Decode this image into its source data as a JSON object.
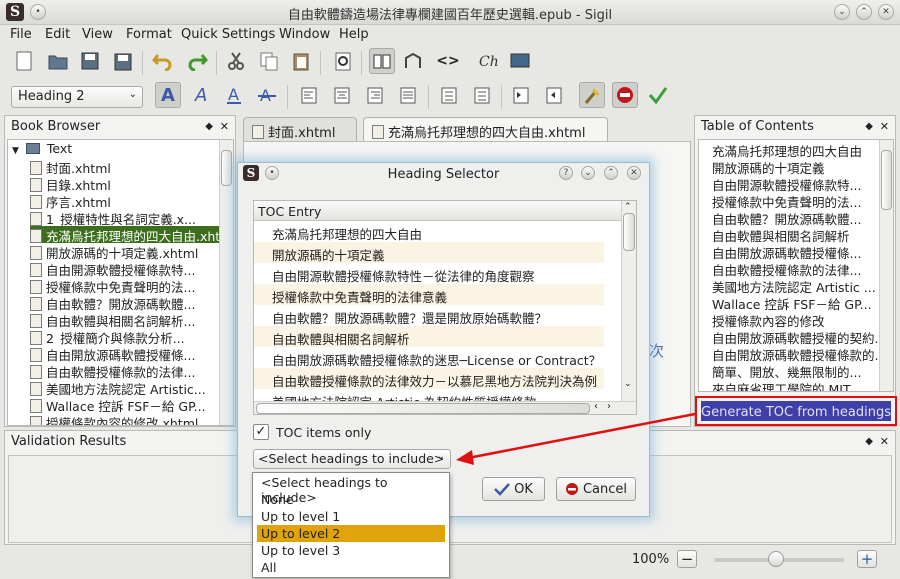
{
  "window": {
    "title": "自由軟體鑄造場法律專欄建國百年歷史選輯.epub - Sigil"
  },
  "menu": [
    "File",
    "Edit",
    "View",
    "Format",
    "Quick Settings",
    "Window",
    "Help"
  ],
  "toolbar": {
    "heading_combo": "Heading 2"
  },
  "book_browser": {
    "title": "Book Browser",
    "folder": "Text",
    "files": [
      "封面.xhtml",
      "目錄.xhtml",
      "序言.xhtml",
      "1_授權特性與名詞定義.x...",
      "充滿烏托邦理想的四大自由.xhtml",
      "開放源碼的十項定義.xhtml",
      "自由開源軟體授權條款特...",
      "授權條款中免責聲明的法...",
      "自由軟體？開放源碼軟體...",
      "自由軟體與相關名詞解析...",
      "2_授權簡介與條款分析...",
      "自由開放源碼軟體授權條...",
      "自由軟體授權條款的法律...",
      "美國地方法院認定 Artistic...",
      "Wallace 控訴 FSF－給 GP...",
      "授權條款內容的修改.xhtml"
    ],
    "selected_index": 4
  },
  "tabs": [
    {
      "label": "封面.xhtml"
    },
    {
      "label": "充滿烏托邦理想的四大自由.xhtml"
    }
  ],
  "toc_panel": {
    "title": "Table of Contents",
    "entries": [
      "充滿烏托邦理想的四大自由",
      "開放源碼的十項定義",
      "自由開源軟體授權條款特...",
      "授權條款中免責聲明的法...",
      "自由軟體？開放源碼軟體...",
      "自由軟體與相關名詞解析",
      "自由開放源碼軟體授權條...",
      "自由軟體授權條款的法律...",
      "美國地方法院認定 Artistic ...",
      "Wallace 控訴 FSF－給 GP...",
      "授權條款內容的修改",
      "自由開放源碼軟體授權的契約...",
      "自由開放源碼軟體授權條款的...",
      "簡單、開放、幾無限制的...",
      "來自麻省理工學院的 MIT ..."
    ],
    "generate_button": "Generate TOC from headings"
  },
  "validation": {
    "title": "Validation Results"
  },
  "zoom": {
    "label": "100%"
  },
  "dialog": {
    "title": "Heading Selector",
    "column_header": "TOC Entry",
    "entries": [
      "充滿烏托邦理想的四大自由",
      "開放源碼的十項定義",
      "自由開源軟體授權條款特性－從法律的角度觀察",
      "授權條款中免責聲明的法律意義",
      "自由軟體？開放源碼軟體？還是開放原始碼軟體？",
      "自由軟體與相關名詞解析",
      "自由開放源碼軟體授權條款的迷思─License or Contract？",
      "自由軟體授權條款的法律效力－以慕尼黑地方法院判決為例",
      "美國地方法院認定 Artistic 為契約性質授權條款"
    ],
    "toc_only_label": "TOC items only",
    "toc_only_checked": true,
    "select_value": "<Select headings to include>",
    "ok_label": "OK",
    "cancel_label": "Cancel",
    "dropdown_options": [
      "<Select headings to include>",
      "None",
      "Up to level 1",
      "Up to level 2",
      "Up to level 3",
      "All"
    ],
    "dropdown_selected": 3,
    "bg_text": "次"
  },
  "colors": {
    "accent": "#e0a30a",
    "selected_tree": "#3c6e1e",
    "highlight_box": "#e01010",
    "arrow": "#e01010",
    "generate_bg": "#3f3fa8"
  }
}
